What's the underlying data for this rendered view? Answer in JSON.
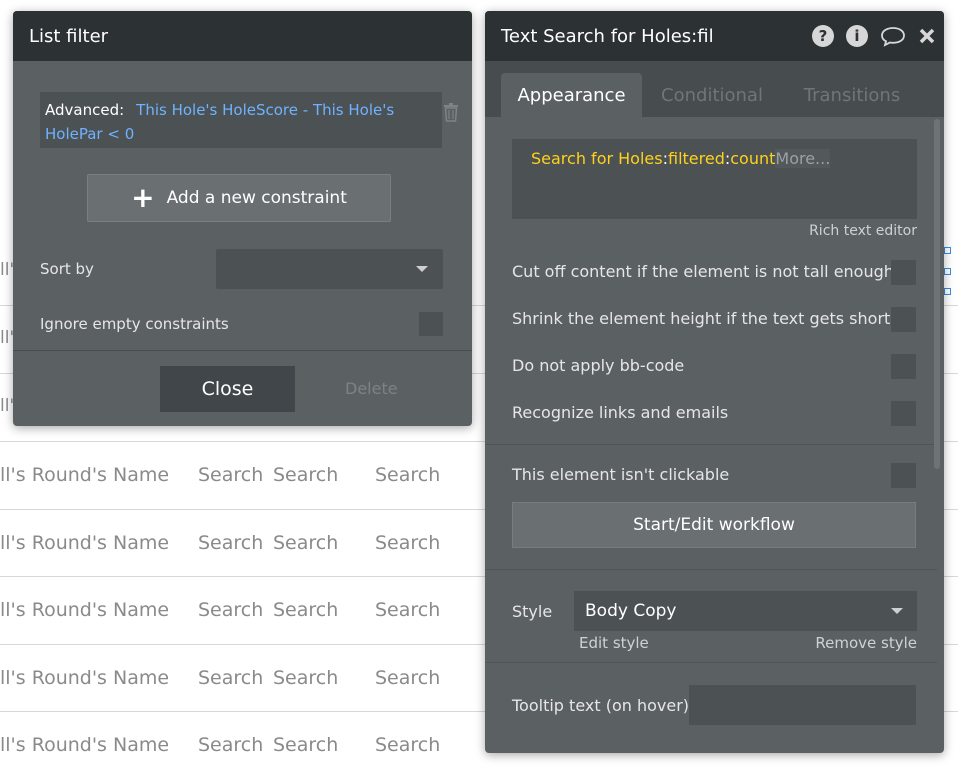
{
  "background_table": {
    "stubs": [
      "ll'",
      "ll'",
      "ll'"
    ],
    "rows": [
      {
        "name": "ll's Round's Name",
        "c1": "Search",
        "c2": "Search",
        "c3": "Search"
      },
      {
        "name": "ll's Round's Name",
        "c1": "Search",
        "c2": "Search",
        "c3": "Search"
      },
      {
        "name": "ll's Round's Name",
        "c1": "Search",
        "c2": "Search",
        "c3": "Search"
      },
      {
        "name": "ll's Round's Name",
        "c1": "Search",
        "c2": "Search",
        "c3": "Search"
      },
      {
        "name": "ll's Round's Name",
        "c1": "Search",
        "c2": "Search",
        "c3": "Search"
      }
    ]
  },
  "list_filter": {
    "title": "List filter",
    "constraint_label": "Advanced:",
    "constraint_expression": "This Hole's HoleScore - This Hole's HolePar < 0",
    "add_constraint": "Add a new constraint",
    "sort_by": "Sort by",
    "sort_value": "",
    "ignore_empty": "Ignore empty constraints",
    "close": "Close",
    "delete": "Delete"
  },
  "props": {
    "title": "Text Search for Holes:fil",
    "tabs": [
      "Appearance",
      "Conditional",
      "Transitions"
    ],
    "expression": {
      "part1": "Search for Holes",
      "sep1": ":",
      "part2": "filtered",
      "sep2": ":",
      "part3": "count",
      "more": "More..."
    },
    "rich_text_editor": "Rich text editor",
    "options": [
      "Cut off content if the element is not tall enough",
      "Shrink the element height if the text gets shorter",
      "Do not apply bb-code",
      "Recognize links and emails"
    ],
    "not_clickable": "This element isn't clickable",
    "workflow_button": "Start/Edit workflow",
    "style_label": "Style",
    "style_value": "Body Copy",
    "edit_style": "Edit style",
    "remove_style": "Remove style",
    "tooltip_label": "Tooltip text (on hover)",
    "tooltip_value": ""
  },
  "colors": {
    "link": "#6fb2ff",
    "expression_yellow": "#ffd21a",
    "panel": "#5b6063",
    "header": "#2c3134"
  }
}
